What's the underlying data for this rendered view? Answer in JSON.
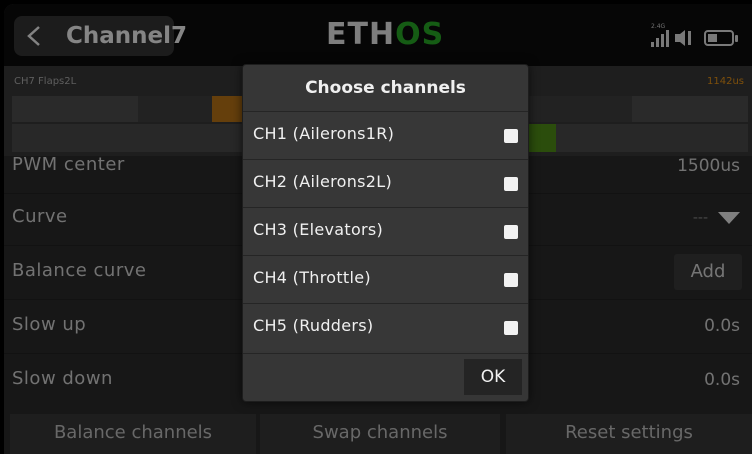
{
  "header": {
    "title": "Channel7",
    "logo_part1": "ETH",
    "logo_part2": "OS",
    "signal_label": "2.4G"
  },
  "monitor": {
    "channel_name": "CH7 Flaps2L",
    "value": "1142us"
  },
  "rows": [
    {
      "label": "PWM center",
      "value": "1500us"
    },
    {
      "label": "Curve",
      "value": "---"
    },
    {
      "label": "Balance curve",
      "button": "Add"
    },
    {
      "label": "Slow up",
      "value": "0.0s"
    },
    {
      "label": "Slow down",
      "value": "0.0s"
    }
  ],
  "bottom_buttons": [
    "Balance channels",
    "Swap channels",
    "Reset settings"
  ],
  "dialog": {
    "title": "Choose channels",
    "channels": [
      {
        "label": "CH1 (Ailerons1R)",
        "checked": false
      },
      {
        "label": "CH2 (Ailerons2L)",
        "checked": false
      },
      {
        "label": "CH3 (Elevators)",
        "checked": false
      },
      {
        "label": "CH4 (Throttle)",
        "checked": false
      },
      {
        "label": "CH5 (Rudders)",
        "checked": false
      }
    ],
    "ok_label": "OK"
  },
  "colors": {
    "accent_green": "#27a826",
    "accent_orange": "#e39014",
    "background": "#2b2b2b"
  }
}
